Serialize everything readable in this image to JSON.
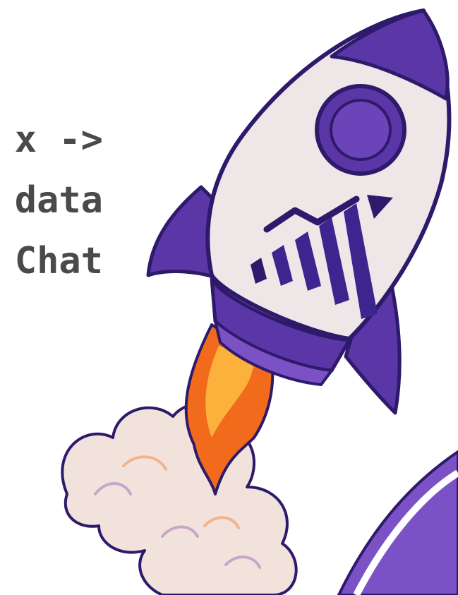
{
  "headline": {
    "lines": [
      "x ->",
      "data",
      "Chat"
    ],
    "color": "#4a4a4a"
  },
  "illustration": {
    "subject": "rocket-illustration",
    "colors": {
      "purple": "#5b36a6",
      "purple_light": "#7b52c6",
      "outline": "#2e1a6b",
      "body": "#efe6e8",
      "flame_outer": "#f26a1b",
      "flame_inner": "#fbb13c",
      "cloud": "#f1e3dc"
    }
  }
}
